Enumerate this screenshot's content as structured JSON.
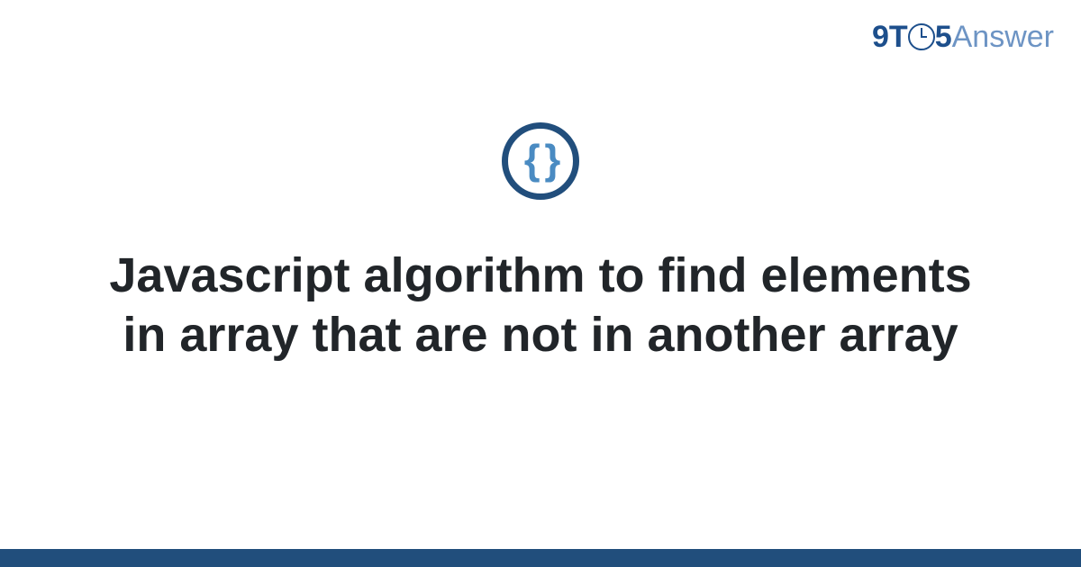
{
  "logo": {
    "part1": "9",
    "part2": "T",
    "part3": "5",
    "part4": "Answer"
  },
  "icon": {
    "glyph": "{ }"
  },
  "title": "Javascript algorithm to find elements in array that are not in another array"
}
